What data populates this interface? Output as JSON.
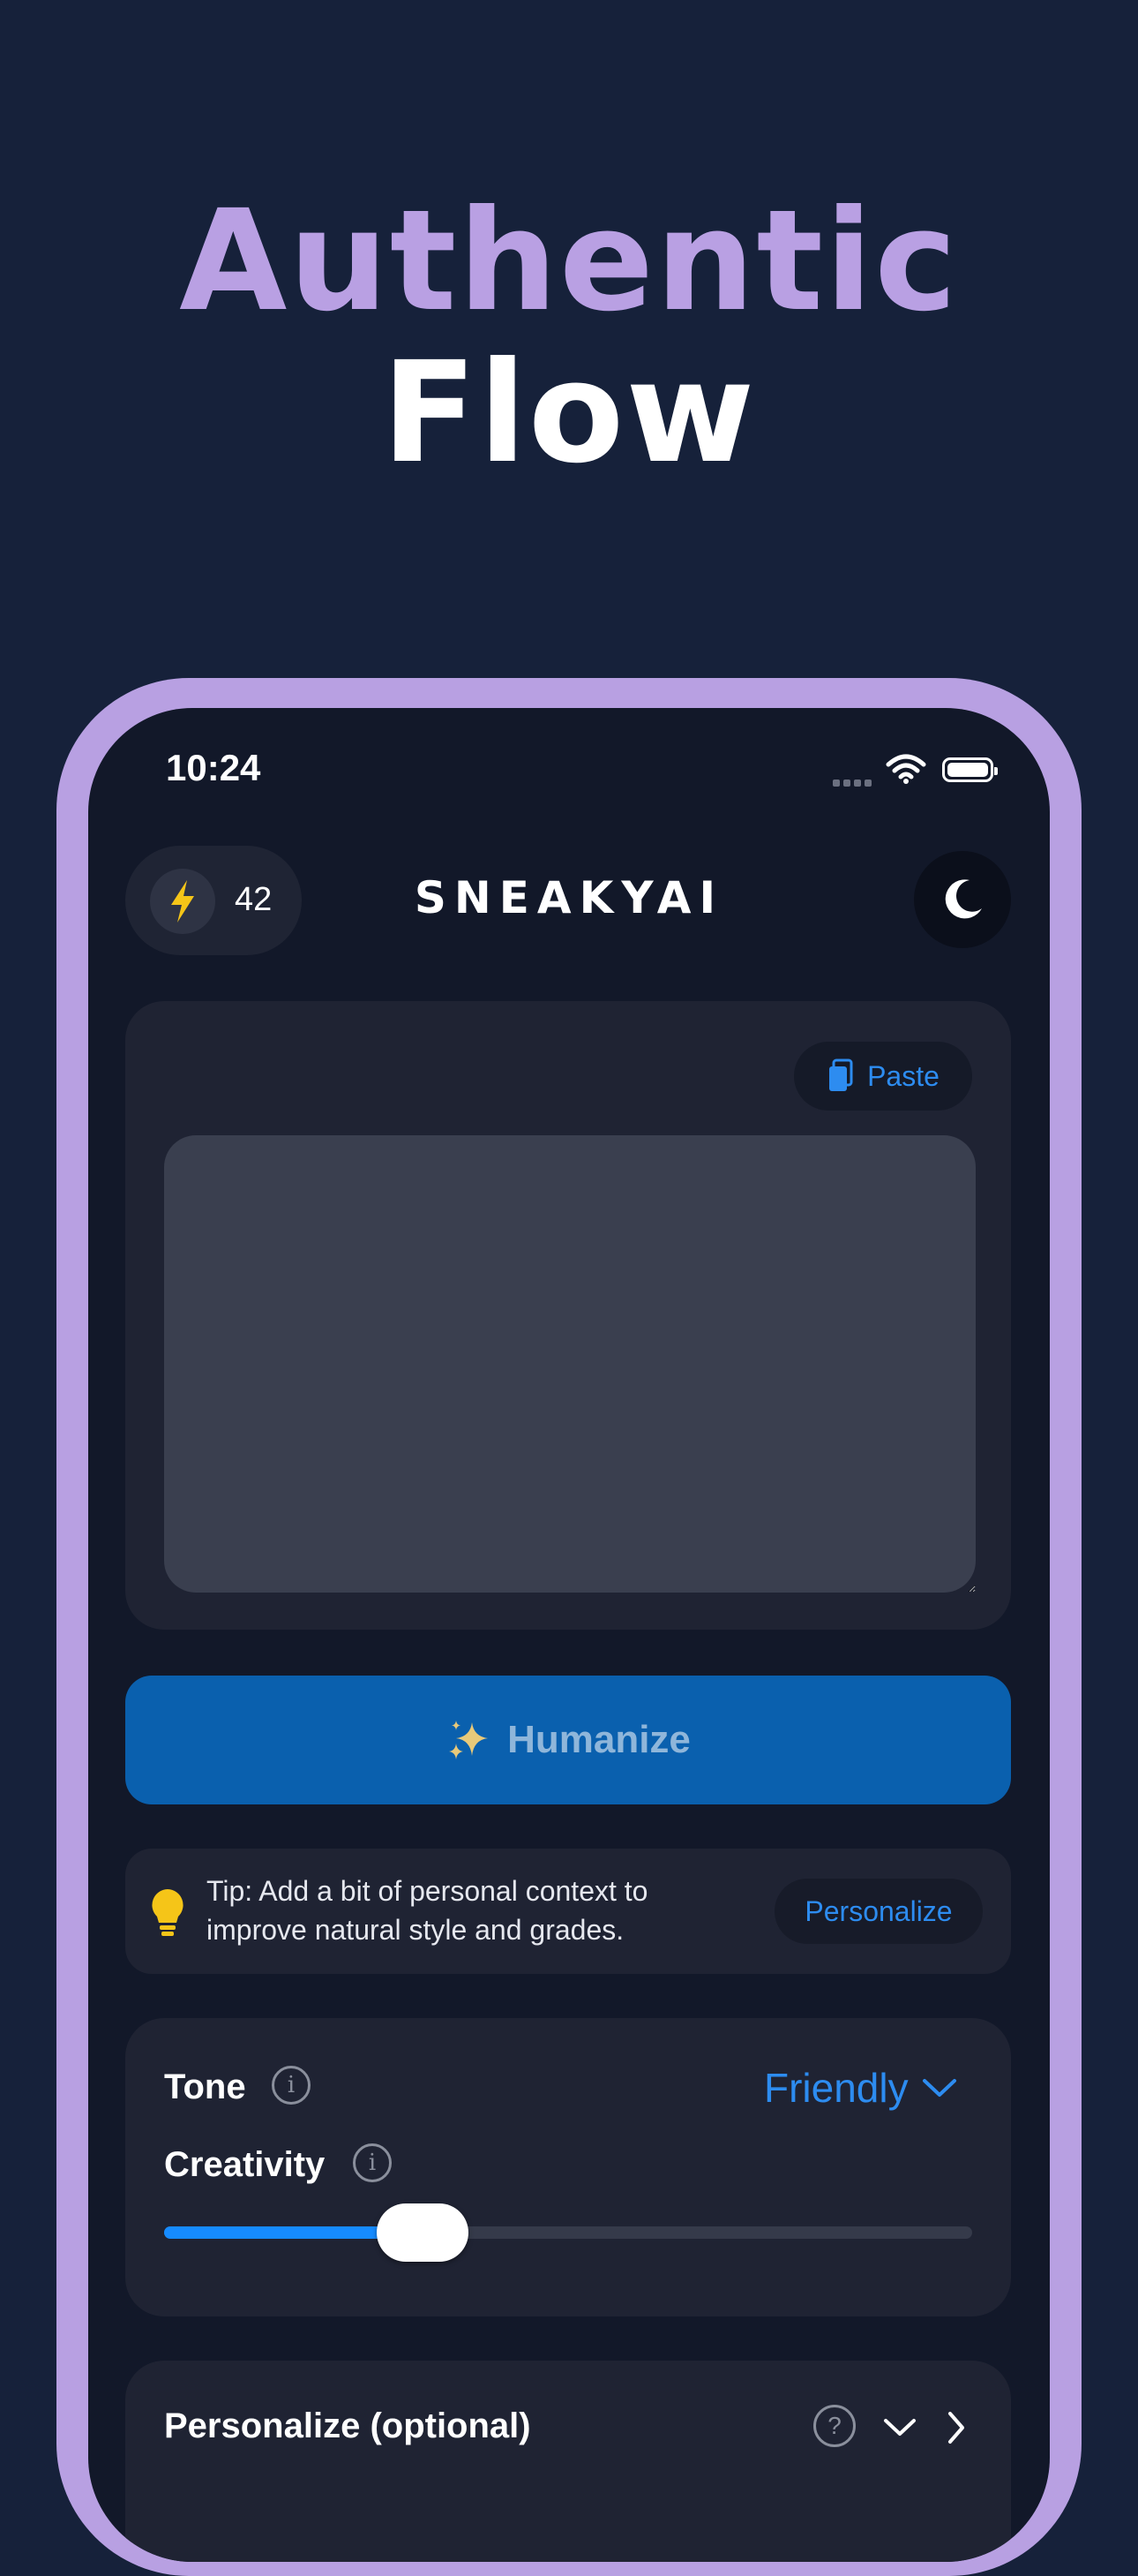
{
  "hero": {
    "line1": "Authentic",
    "line2": "Flow"
  },
  "status_bar": {
    "time": "10:24"
  },
  "header": {
    "credits": "42",
    "logo": "SNEAKYAI",
    "theme_icon": "moon-icon",
    "credit_icon": "bolt-icon"
  },
  "input": {
    "paste_label": "Paste",
    "paste_icon": "clipboard-icon",
    "text": ""
  },
  "humanize": {
    "label": "Humanize",
    "icon": "sparkles-icon"
  },
  "tip": {
    "text": "Tip: Add a bit of personal context to improve natural style and grades.",
    "button": "Personalize"
  },
  "settings": {
    "tone_label": "Tone",
    "tone_value": "Friendly",
    "creativity_label": "Creativity",
    "creativity_level": 0.32
  },
  "personalize": {
    "title": "Personalize (optional)"
  },
  "colors": {
    "accent": "#2d8cf0",
    "frame": "#b8a0e2",
    "button": "#0a60ae",
    "background": "#16213a"
  }
}
